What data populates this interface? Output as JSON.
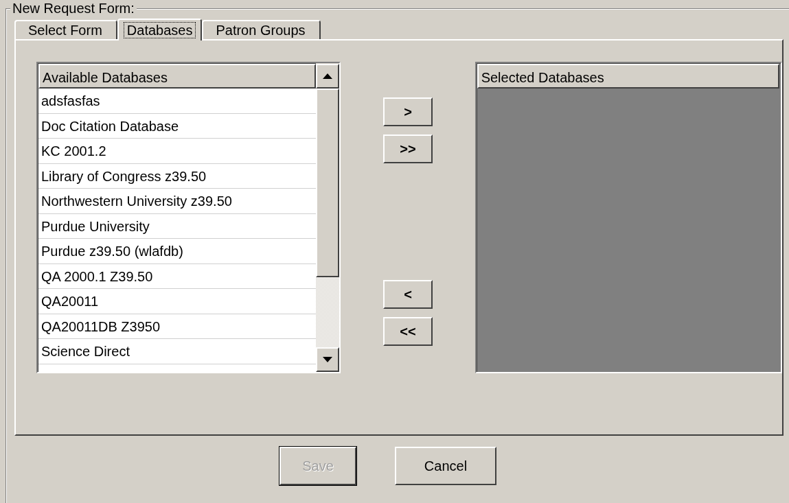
{
  "group_title": "New  Request Form:",
  "tabs": [
    {
      "label": "Select Form",
      "selected": false
    },
    {
      "label": "Databases",
      "selected": true
    },
    {
      "label": "Patron Groups",
      "selected": false
    }
  ],
  "available": {
    "header": "Available Databases",
    "items": [
      "adsfasfas",
      "Doc Citation Database",
      "KC 2001.2",
      "Library of Congress z39.50",
      "Northwestern University z39.50",
      "Purdue University",
      "Purdue z39.50 (wlafdb)",
      "QA 2000.1 Z39.50",
      "QA20011",
      "QA20011DB Z3950",
      "Science Direct"
    ]
  },
  "move_buttons": [
    {
      "label": ">"
    },
    {
      "label": ">>"
    },
    {
      "label": "<"
    },
    {
      "label": "<<"
    }
  ],
  "selected_list": {
    "header": "Selected Databases"
  },
  "buttons": [
    {
      "label": "Save",
      "disabled": true
    },
    {
      "label": "Cancel",
      "disabled": false
    }
  ]
}
